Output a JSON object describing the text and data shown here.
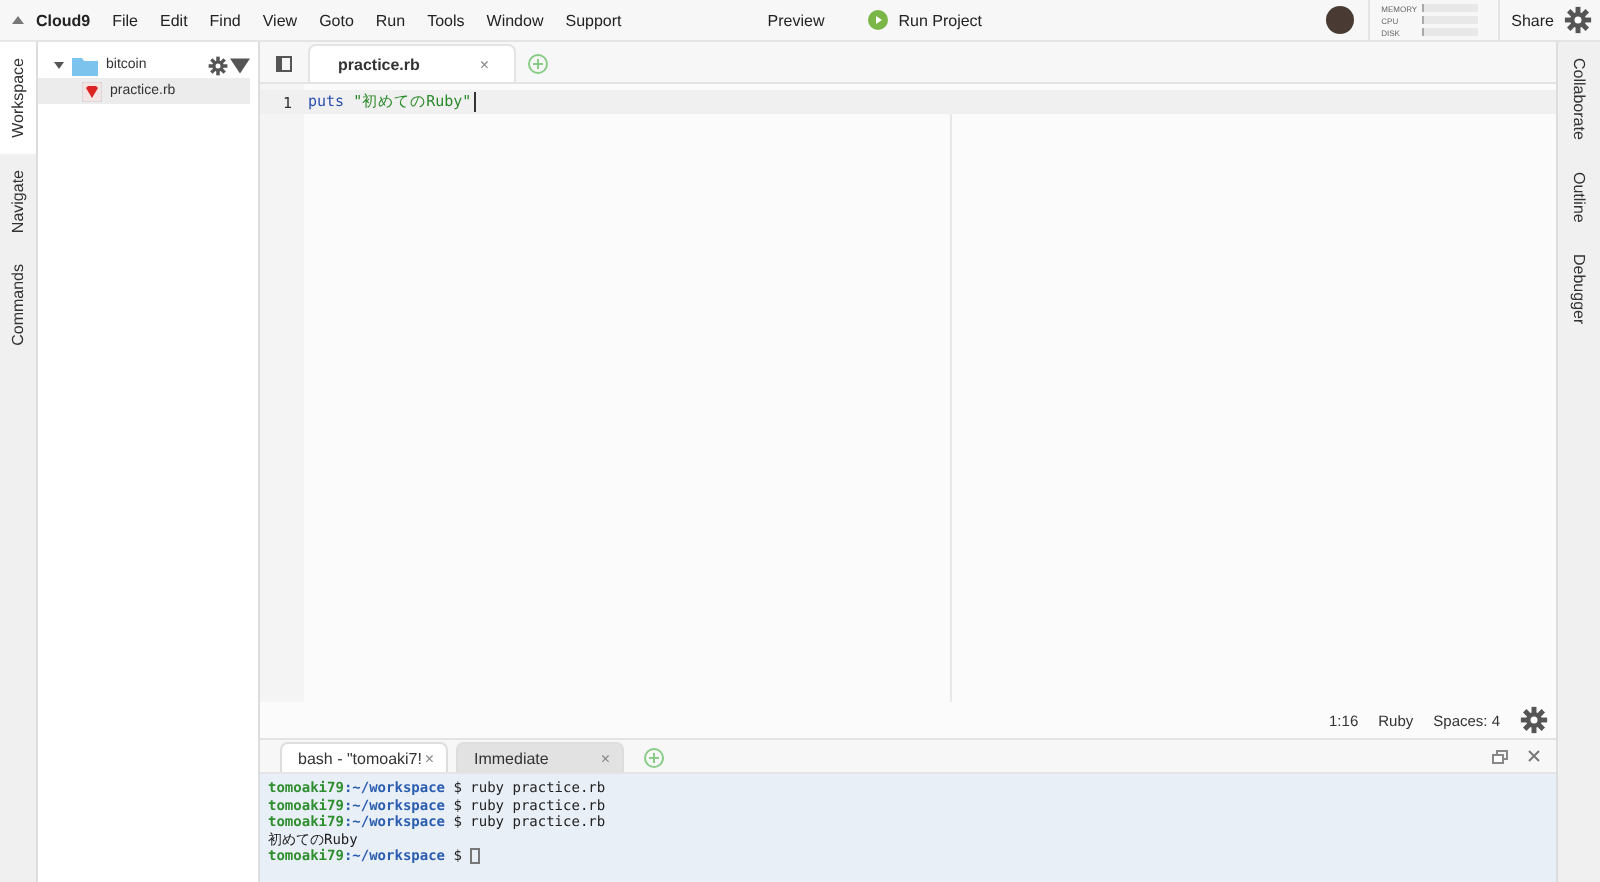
{
  "menu_bar": {
    "brand": "Cloud9",
    "items": [
      "File",
      "Edit",
      "Find",
      "View",
      "Goto",
      "Run",
      "Tools",
      "Window",
      "Support"
    ],
    "preview": "Preview",
    "run": "Run Project",
    "meters": [
      {
        "label": "MEMORY",
        "level": 0.05
      },
      {
        "label": "CPU",
        "level": 0.03
      },
      {
        "label": "DISK",
        "level": 0.04
      }
    ],
    "share": "Share"
  },
  "left_tabs": [
    {
      "label": "Workspace",
      "selected": true
    },
    {
      "label": "Navigate",
      "selected": false
    },
    {
      "label": "Commands",
      "selected": false
    }
  ],
  "right_tabs": [
    {
      "label": "Collaborate",
      "selected": false
    },
    {
      "label": "Outline",
      "selected": false
    },
    {
      "label": "Debugger",
      "selected": false
    }
  ],
  "tree": [
    {
      "name": "bitcoin",
      "kind": "folder",
      "expanded": true,
      "selected": false,
      "children": [
        {
          "name": "practice.rb",
          "kind": "file",
          "selected": true
        }
      ]
    }
  ],
  "editor": {
    "tabs": [
      {
        "label": "practice.rb",
        "close": "×",
        "selected": true
      }
    ],
    "lines": [
      {
        "number": "1",
        "tokens": [
          {
            "kind": "keyword",
            "text": "puts"
          },
          {
            "kind": "string",
            "text": "\"初めてのRuby\""
          }
        ]
      }
    ],
    "status": {
      "position": "1:16",
      "language": "Ruby",
      "indent": "Spaces: 4"
    }
  },
  "console": {
    "tabs": [
      {
        "label": "bash - \"tomoaki7!",
        "close": "×",
        "selected": true
      },
      {
        "label": "Immediate",
        "close": "×",
        "selected": false
      }
    ],
    "lines": [
      {
        "kind": "prompt",
        "user": "tomoaki79",
        "path": ":~/workspace",
        "command": "$ ruby practice.rb"
      },
      {
        "kind": "prompt",
        "user": "tomoaki79",
        "path": ":~/workspace",
        "command": "$ ruby practice.rb"
      },
      {
        "kind": "prompt",
        "user": "tomoaki79",
        "path": ":~/workspace",
        "command": "$ ruby practice.rb"
      },
      {
        "kind": "output",
        "text": "初めてのRuby"
      },
      {
        "kind": "prompt",
        "user": "tomoaki79",
        "path": ":~/workspace",
        "command": "$",
        "cursor": true
      }
    ]
  }
}
